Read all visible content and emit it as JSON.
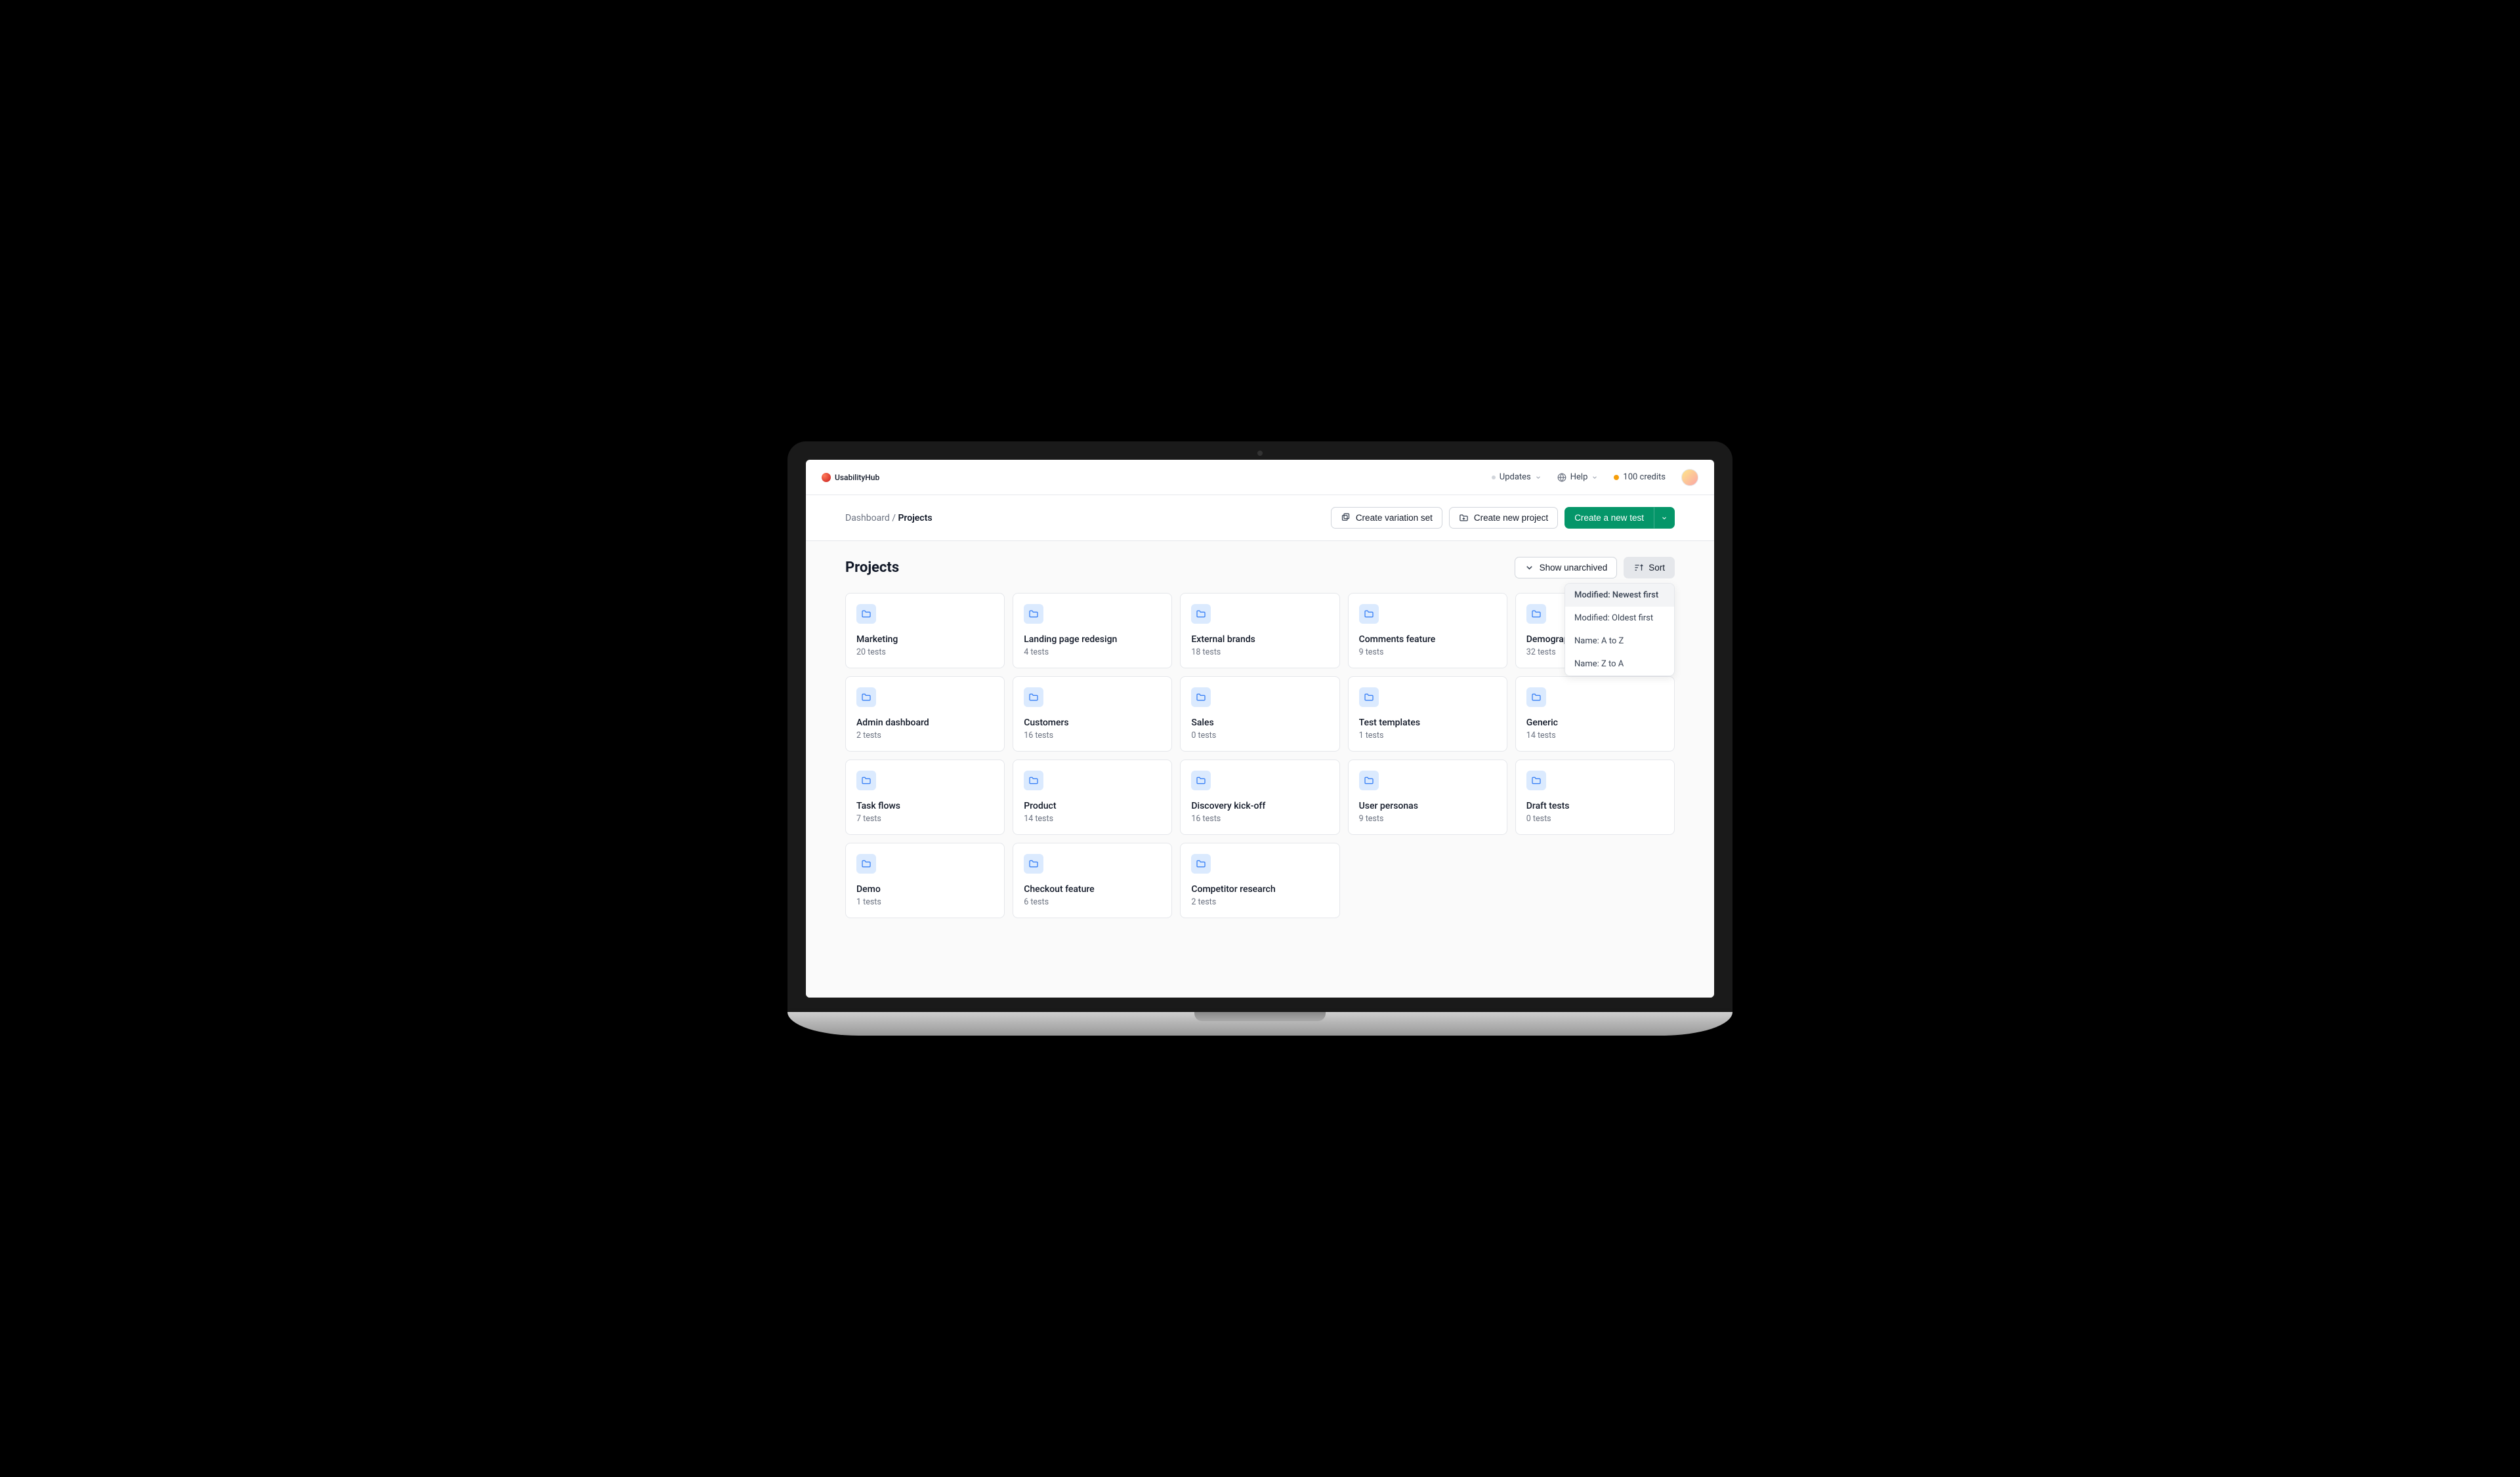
{
  "brand": {
    "name": "UsabilityHub"
  },
  "topbar": {
    "updates": "Updates",
    "help": "Help",
    "credits": "100 credits"
  },
  "breadcrumb": {
    "root": "Dashboard",
    "separator": " / ",
    "current": "Projects"
  },
  "actions": {
    "create_variation_set": "Create variation set",
    "create_new_project": "Create new project",
    "create_new_test": "Create a new test"
  },
  "page": {
    "title": "Projects",
    "show_unarchived": "Show unarchived",
    "sort": "Sort"
  },
  "sort_options": [
    {
      "label": "Modified: Newest first",
      "selected": true
    },
    {
      "label": "Modified: Oldest first",
      "selected": false
    },
    {
      "label": "Name: A to Z",
      "selected": false
    },
    {
      "label": "Name: Z to A",
      "selected": false
    }
  ],
  "projects": [
    {
      "name": "Marketing",
      "subtitle": "20 tests"
    },
    {
      "name": "Landing page redesign",
      "subtitle": "4 tests"
    },
    {
      "name": "External brands",
      "subtitle": "18 tests"
    },
    {
      "name": "Comments feature",
      "subtitle": "9 tests"
    },
    {
      "name": "Demographics",
      "subtitle": "32 tests"
    },
    {
      "name": "Admin dashboard",
      "subtitle": "2 tests"
    },
    {
      "name": "Customers",
      "subtitle": "16 tests"
    },
    {
      "name": "Sales",
      "subtitle": "0 tests"
    },
    {
      "name": "Test templates",
      "subtitle": "1 tests"
    },
    {
      "name": "Generic",
      "subtitle": "14 tests"
    },
    {
      "name": "Task flows",
      "subtitle": "7 tests"
    },
    {
      "name": "Product",
      "subtitle": "14 tests"
    },
    {
      "name": "Discovery kick-off",
      "subtitle": "16 tests"
    },
    {
      "name": "User personas",
      "subtitle": "9 tests"
    },
    {
      "name": "Draft tests",
      "subtitle": "0 tests"
    },
    {
      "name": "Demo",
      "subtitle": "1 tests"
    },
    {
      "name": "Checkout feature",
      "subtitle": "6 tests"
    },
    {
      "name": "Competitor research",
      "subtitle": "2 tests"
    }
  ]
}
